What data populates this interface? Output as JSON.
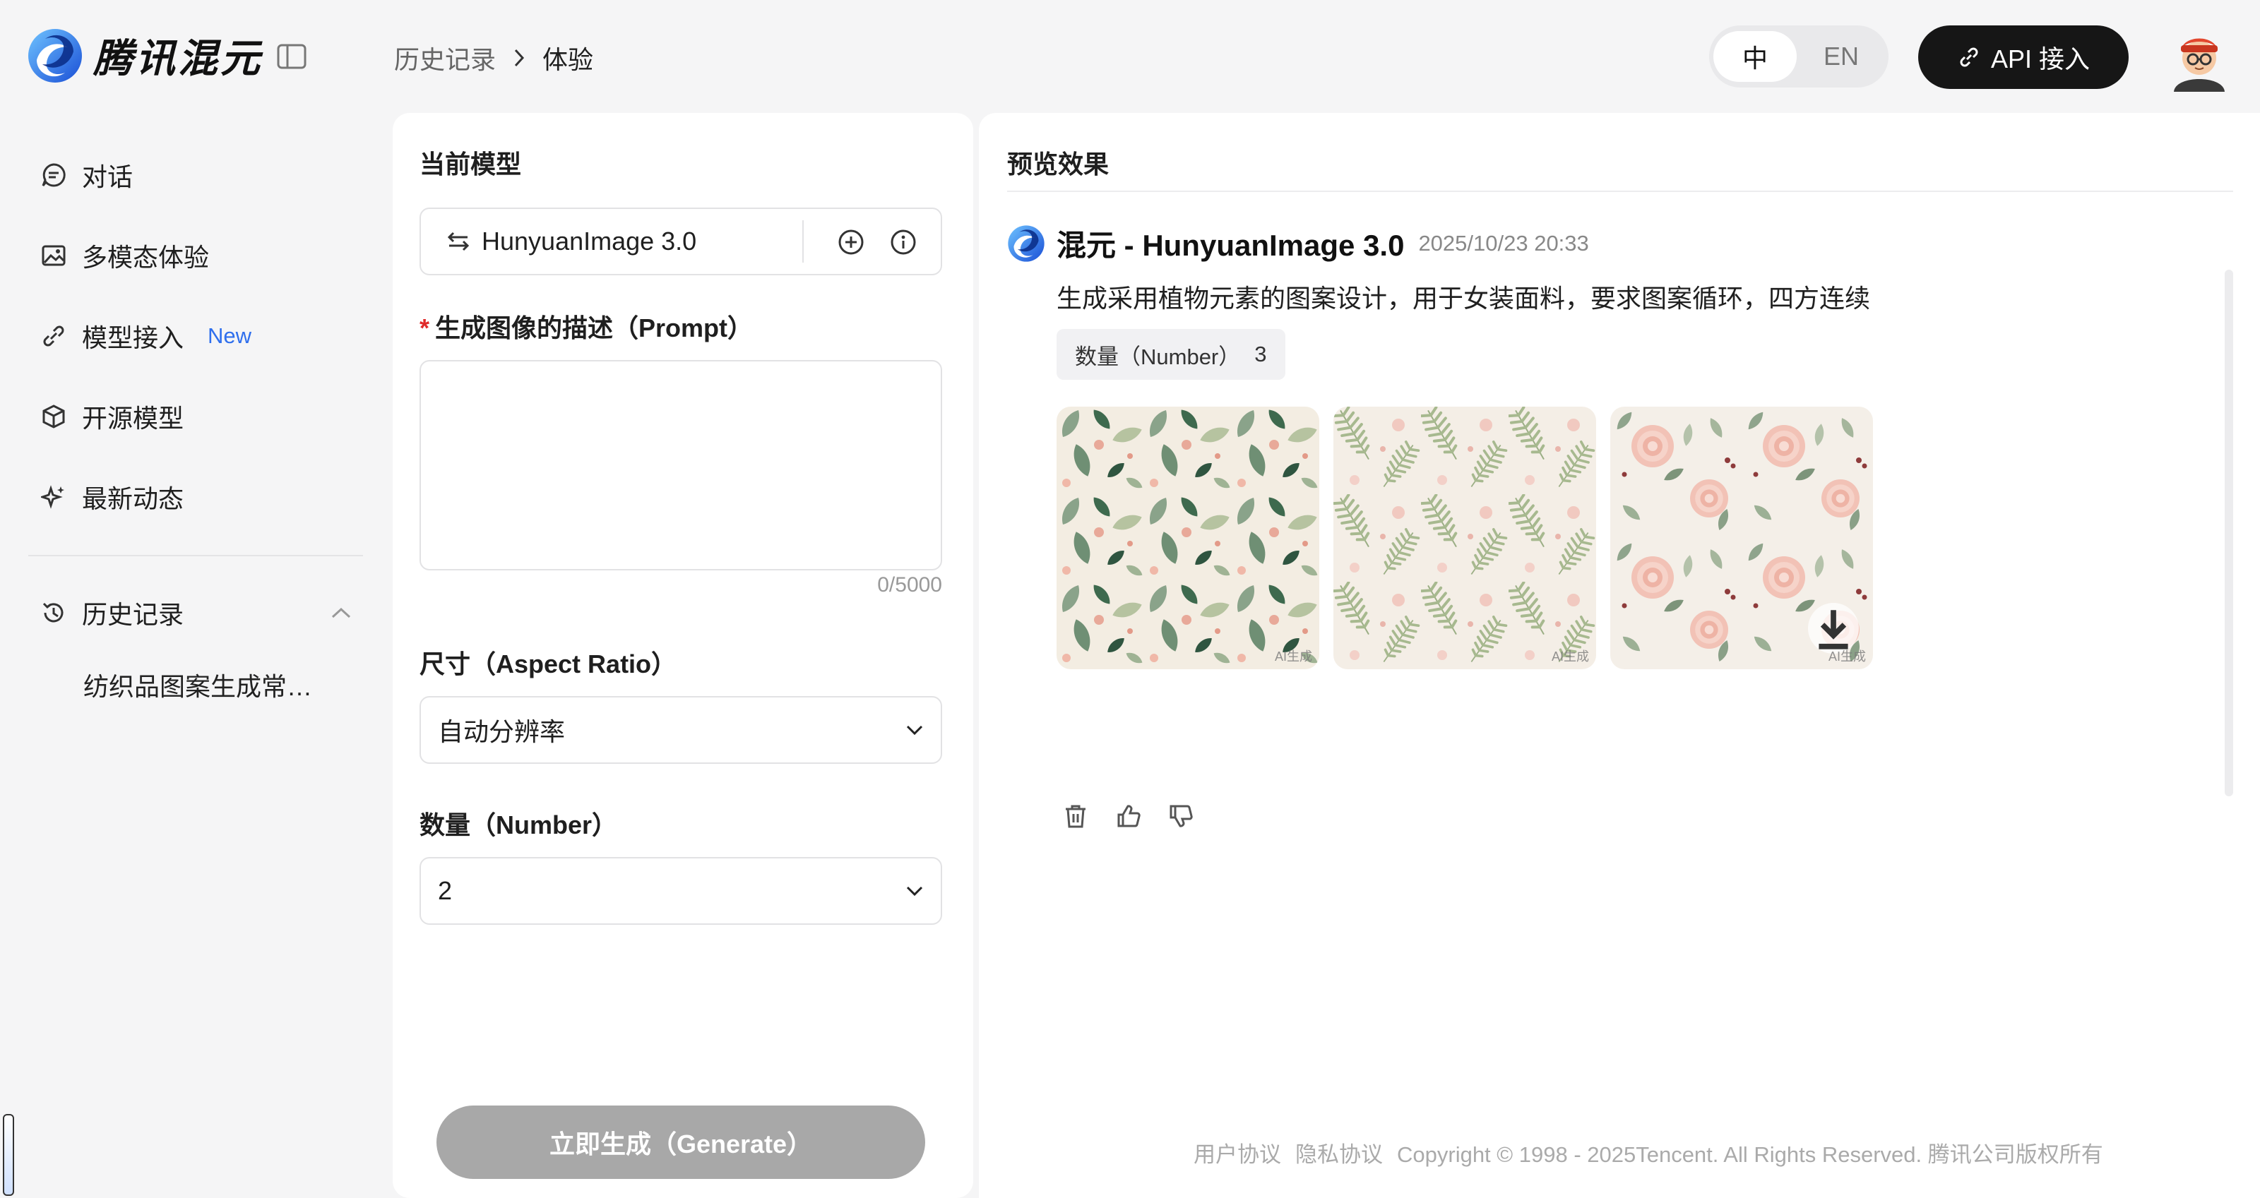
{
  "brand": {
    "name": "腾讯混元"
  },
  "breadcrumb": {
    "parent": "历史记录",
    "current": "体验"
  },
  "language": {
    "zh": "中",
    "en": "EN",
    "active": "zh"
  },
  "api_button": {
    "label": "API 接入"
  },
  "sidebar": {
    "items": [
      {
        "label": "对话",
        "icon": "chat-icon"
      },
      {
        "label": "多模态体验",
        "icon": "image-icon"
      },
      {
        "label": "模型接入",
        "icon": "plug-icon",
        "badge": "New"
      },
      {
        "label": "开源模型",
        "icon": "cube-icon"
      },
      {
        "label": "最新动态",
        "icon": "sparkle-icon"
      }
    ],
    "history": {
      "label": "历史记录",
      "items": [
        "纺织品图案生成常见问题"
      ]
    }
  },
  "form": {
    "model_section": "当前模型",
    "model_name": "HunyuanImage 3.0",
    "prompt_label": "生成图像的描述（Prompt）",
    "prompt_value": "",
    "prompt_counter": "0/5000",
    "size_label": "尺寸（Aspect Ratio）",
    "size_value": "自动分辨率",
    "number_label": "数量（Number）",
    "number_value": "2",
    "generate_label": "立即生成（Generate）"
  },
  "preview": {
    "title": "预览效果",
    "result": {
      "title": "混元 - HunyuanImage 3.0",
      "time": "2025/10/23 20:33",
      "prompt": "生成采用植物元素的图案设计，用于女装面料，要求图案循环，四方连续",
      "tag_label": "数量（Number）",
      "tag_value": "3",
      "images": [
        {
          "name": "leaf-pattern-image"
        },
        {
          "name": "fern-pattern-image"
        },
        {
          "name": "peony-pattern-image"
        }
      ],
      "watermark": "AI生成"
    }
  },
  "footer": {
    "user_agreement": "用户协议",
    "privacy": "隐私协议",
    "copyright": "Copyright © 1998 - 2025Tencent. All Rights Reserved. 腾讯公司版权所有"
  },
  "colors": {
    "accent": "#2f6fed",
    "dark_button": "#161616",
    "disabled_button": "#a8a8a8",
    "required": "#e02a2a"
  }
}
